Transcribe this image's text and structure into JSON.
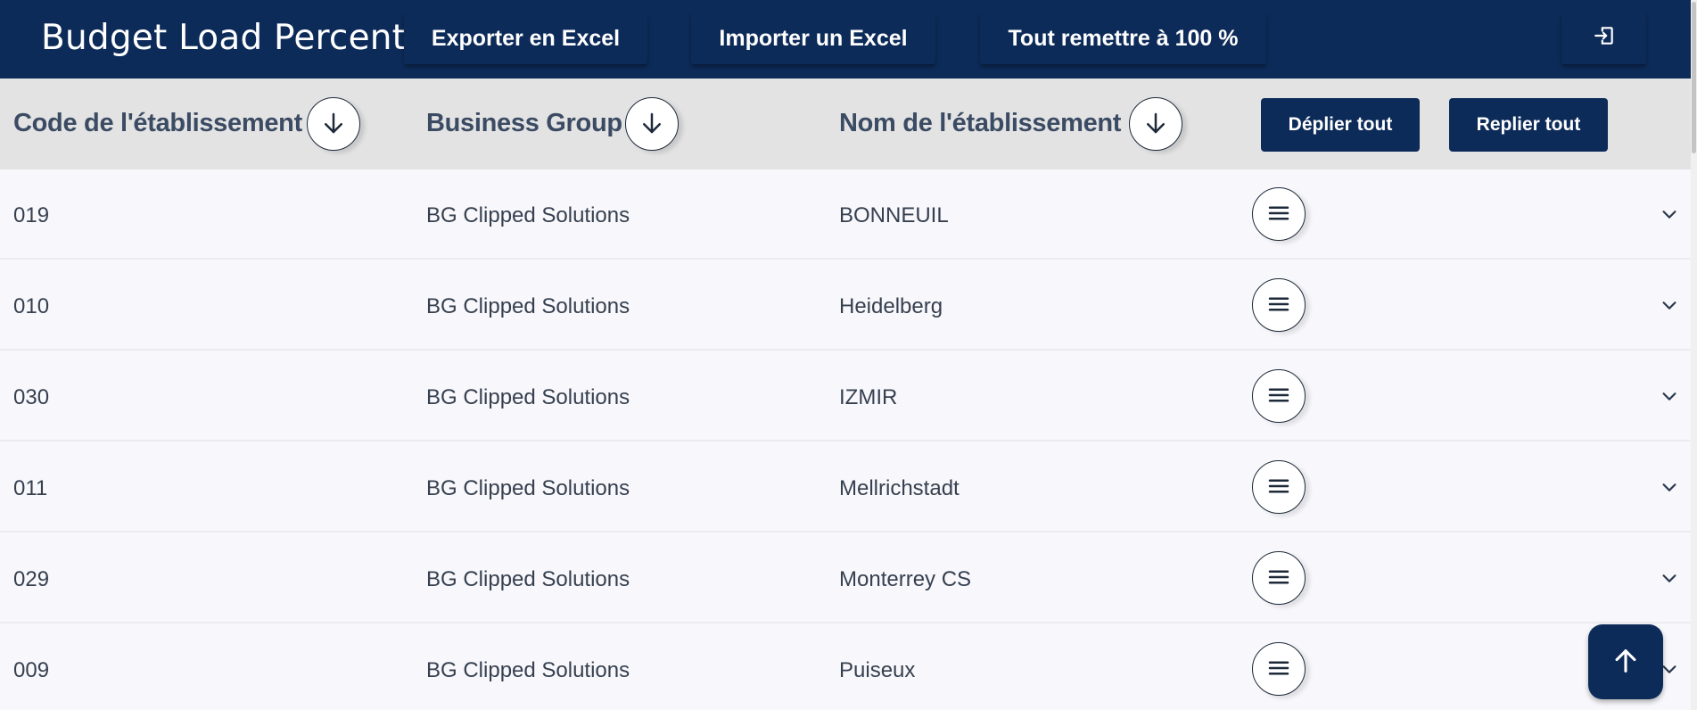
{
  "header": {
    "title": "Budget Load Percent",
    "buttons": {
      "export": "Exporter en Excel",
      "import": "Importer un Excel",
      "reset": "Tout remettre à 100 %"
    },
    "logout_icon": "logout-icon"
  },
  "table": {
    "columns": {
      "code": "Code de l'établissement",
      "business_group": "Business Group",
      "name": "Nom de l'établissement"
    },
    "sort_icon": "arrow-down-icon",
    "actions": {
      "expand_all": "Déplier tout",
      "collapse_all": "Replier tout"
    },
    "rows": [
      {
        "code": "019",
        "business_group": "BG Clipped Solutions",
        "name": "BONNEUIL"
      },
      {
        "code": "010",
        "business_group": "BG Clipped Solutions",
        "name": "Heidelberg"
      },
      {
        "code": "030",
        "business_group": "BG Clipped Solutions",
        "name": "IZMIR"
      },
      {
        "code": "011",
        "business_group": "BG Clipped Solutions",
        "name": "Mellrichstadt"
      },
      {
        "code": "029",
        "business_group": "BG Clipped Solutions",
        "name": "Monterrey CS"
      },
      {
        "code": "009",
        "business_group": "BG Clipped Solutions",
        "name": "Puiseux"
      }
    ]
  },
  "fab_icon": "arrow-up-icon",
  "colors": {
    "primary": "#0d2b59",
    "header_bg": "#e3e3e3",
    "row_bg": "#f8f8fc"
  }
}
